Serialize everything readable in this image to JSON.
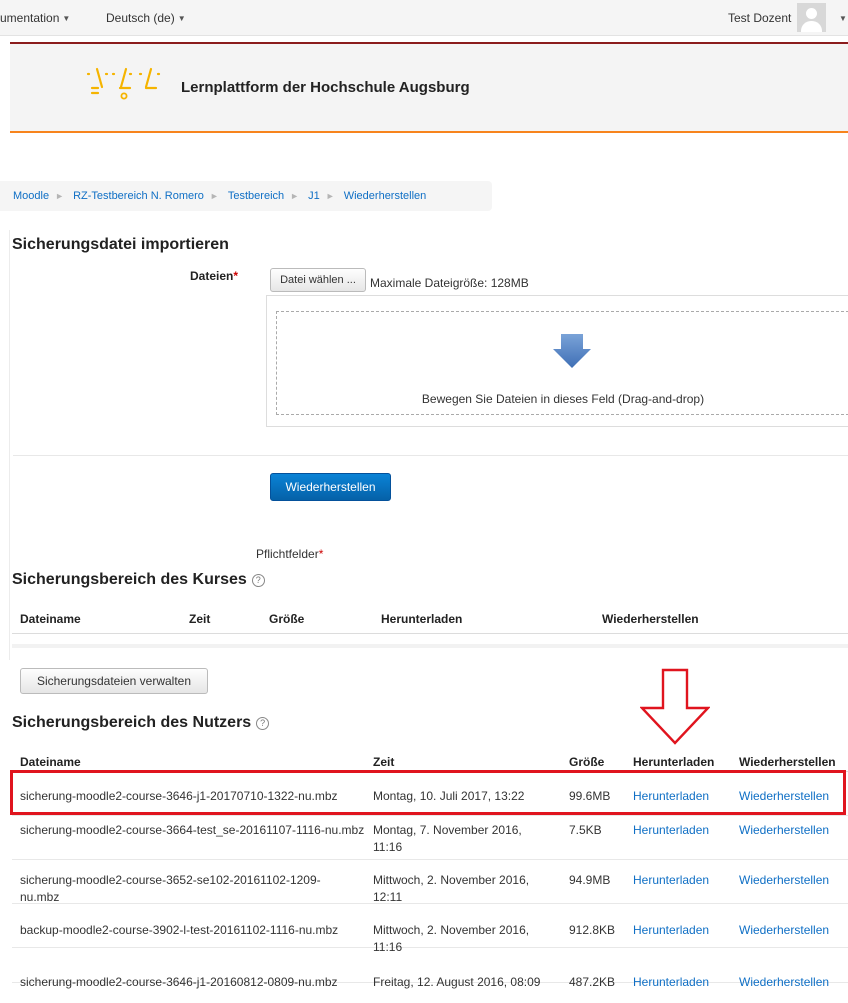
{
  "topnav": {
    "documentation": "umentation",
    "language": "Deutsch (de)",
    "user": "Test Dozent"
  },
  "header": {
    "site_title": "Lernplattform der Hochschule Augsburg"
  },
  "breadcrumb": [
    "Moodle",
    "RZ-Testbereich N. Romero",
    "Testbereich",
    "J1",
    "Wiederherstellen"
  ],
  "import": {
    "heading": "Sicherungsdatei importieren",
    "field_label": "Dateien",
    "required_mark": "*",
    "choose_button": "Datei wählen ...",
    "max_size": "Maximale Dateigröße: 128MB",
    "drop_text": "Bewegen Sie Dateien in dieses Feld (Drag-and-drop)",
    "restore_button": "Wiederherstellen",
    "required_note": "Pflichtfelder"
  },
  "course_backup": {
    "heading": "Sicherungsbereich des Kurses",
    "columns": [
      "Dateiname",
      "Zeit",
      "Größe",
      "Herunterladen",
      "Wiederherstellen"
    ],
    "manage_button": "Sicherungsdateien verwalten"
  },
  "user_backup": {
    "heading": "Sicherungsbereich des Nutzers",
    "columns": [
      "Dateiname",
      "Zeit",
      "Größe",
      "Herunterladen",
      "Wiederherstellen"
    ],
    "rows": [
      {
        "file": "sicherung-moodle2-course-3646-j1-20170710-1322-nu.mbz",
        "time": "Montag, 10. Juli 2017, 13:22",
        "size": "99.6MB",
        "download": "Herunterladen",
        "restore": "Wiederherstellen"
      },
      {
        "file": "sicherung-moodle2-course-3664-test_se-20161107-1116-nu.mbz",
        "time": "Montag, 7. November 2016, 11:16",
        "size": "7.5KB",
        "download": "Herunterladen",
        "restore": "Wiederherstellen"
      },
      {
        "file": "sicherung-moodle2-course-3652-se102-20161102-1209-nu.mbz",
        "time": "Mittwoch, 2. November 2016, 12:11",
        "size": "94.9MB",
        "download": "Herunterladen",
        "restore": "Wiederherstellen"
      },
      {
        "file": "backup-moodle2-course-3902-l-test-20161102-1116-nu.mbz",
        "time": "Mittwoch, 2. November 2016, 11:16",
        "size": "912.8KB",
        "download": "Herunterladen",
        "restore": "Wiederherstellen"
      },
      {
        "file": "sicherung-moodle2-course-3646-j1-20160812-0809-nu.mbz",
        "time": "Freitag, 12. August 2016, 08:09",
        "size": "487.2KB",
        "download": "Herunterladen",
        "restore": "Wiederherstellen"
      }
    ]
  },
  "colors": {
    "primary": "#0a6ebd",
    "link": "#0f6fc5",
    "header_top_border": "#8b1c1c",
    "header_bottom_border": "#f7841d",
    "logo": "#f5b400",
    "highlight": "#e0141e"
  }
}
